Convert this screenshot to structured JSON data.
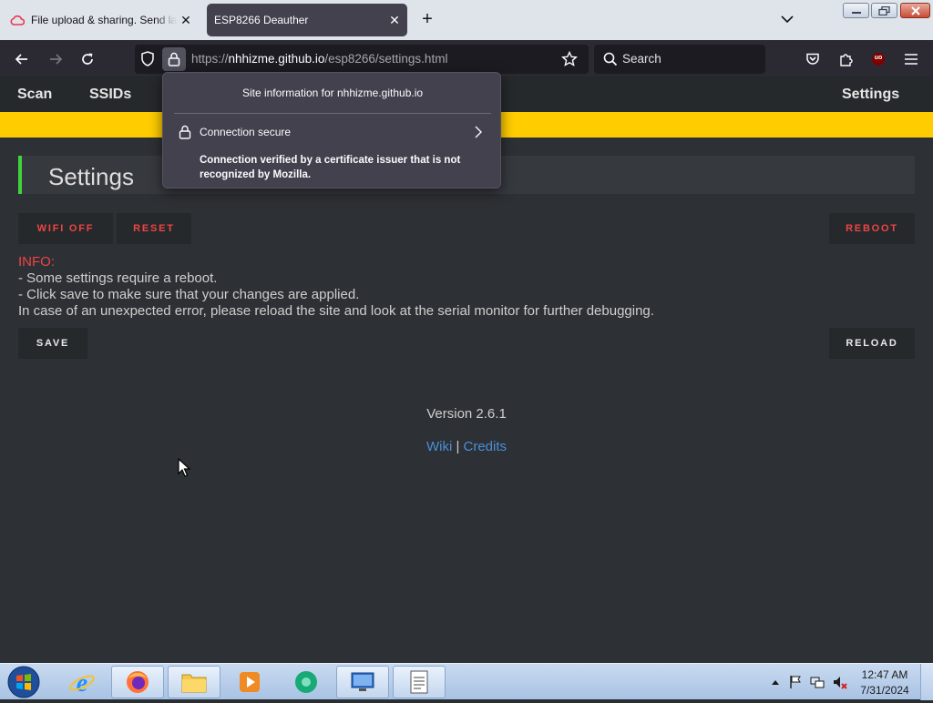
{
  "browser": {
    "tabs": [
      {
        "title": "File upload & sharing. Send large files",
        "active": false,
        "icon": "cloud-icon"
      },
      {
        "title": "ESP8266 Deauther",
        "active": true,
        "icon": ""
      }
    ],
    "new_tab_label": "+",
    "url": {
      "prefix": "https://",
      "host": "nhhizme.github.io",
      "path": "/esp8266/settings.html"
    },
    "search_placeholder": "Search",
    "extension_badge": "uo"
  },
  "site_info_popup": {
    "title": "Site information for nhhizme.github.io",
    "connection_label": "Connection secure",
    "detail": "Connection verified by a certificate issuer that is not recognized by Mozilla."
  },
  "site_nav": {
    "items": [
      "Scan",
      "SSIDs"
    ],
    "right_item": "Settings"
  },
  "page": {
    "heading": "Settings",
    "buttons": {
      "wifi_off": "WIFI OFF",
      "reset": "RESET",
      "reboot": "REBOOT",
      "save": "SAVE",
      "reload": "RELOAD"
    },
    "info": {
      "label": "INFO:",
      "lines": [
        "- Some settings require a reboot.",
        "- Click save to make sure that your changes are applied.",
        "In case of an unexpected error, please reload the site and look at the serial monitor for further debugging."
      ]
    },
    "version": "Version 2.6.1",
    "links": {
      "wiki": "Wiki",
      "separator": " | ",
      "credits": "Credits"
    }
  },
  "taskbar": {
    "items": [
      "internet-explorer-icon",
      "firefox-icon",
      "file-explorer-icon",
      "media-player-icon",
      "app-icon",
      "remote-desktop-icon",
      "notepad-icon"
    ],
    "clock": {
      "time": "12:47 AM",
      "date": "7/31/2024"
    }
  },
  "colors": {
    "accent_yellow": "#ffcc00",
    "accent_red": "#ef4444",
    "accent_green": "#3fd33f",
    "link_blue": "#4a90d9"
  }
}
